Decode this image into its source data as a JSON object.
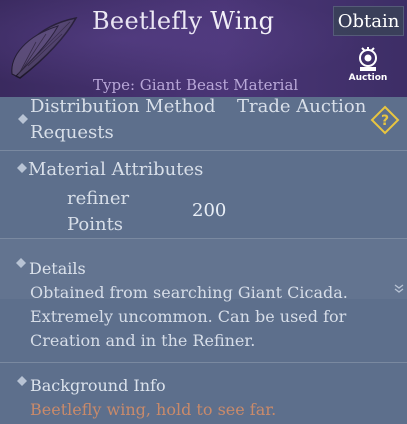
{
  "item": {
    "name": "Beetlefly Wing",
    "type": "Type: Giant Beast Material",
    "obtain_label": "Obtain",
    "auction_label": "Auction",
    "icon": "wing-icon"
  },
  "distribution": {
    "label_line1": "Distribution Method",
    "label_line2": "Requests",
    "value": "Trade Auction"
  },
  "attributes": {
    "title": "Material Attributes",
    "refiner_line1": "refiner",
    "refiner_line2": "Points",
    "refiner_value": "200"
  },
  "details": {
    "title": "Details",
    "lines": [
      "Obtained from searching Giant Cicada.",
      "Extremely uncommon. Can be used for",
      "Creation and in the Refiner."
    ]
  },
  "background": {
    "title": "Background Info",
    "text": "Beetlefly wing, hold to see far."
  },
  "colors": {
    "header": "#4a3576",
    "panel": "#5d6f8c",
    "flavor": "#c98a6a",
    "help": "#e8c540"
  }
}
